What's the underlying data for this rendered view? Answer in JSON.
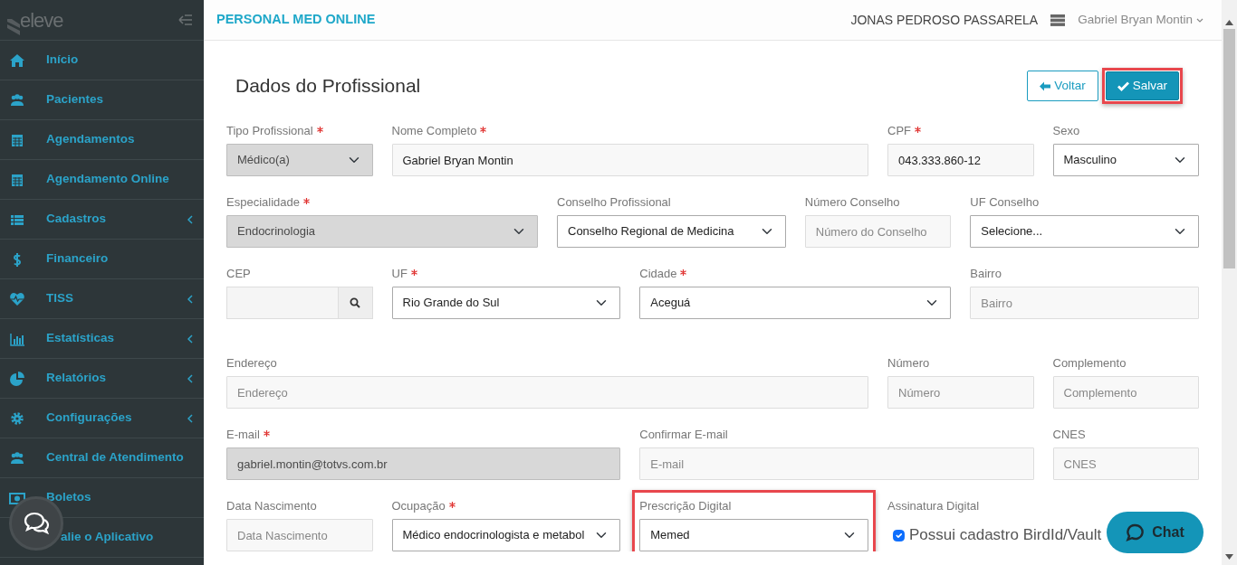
{
  "sidebar": {
    "logo": "eleve",
    "items": [
      {
        "label": "Início",
        "has_submenu": false
      },
      {
        "label": "Pacientes",
        "has_submenu": false
      },
      {
        "label": "Agendamentos",
        "has_submenu": false
      },
      {
        "label": "Agendamento Online",
        "has_submenu": false
      },
      {
        "label": "Cadastros",
        "has_submenu": true
      },
      {
        "label": "Financeiro",
        "has_submenu": false
      },
      {
        "label": "TISS",
        "has_submenu": true
      },
      {
        "label": "Estatísticas",
        "has_submenu": true
      },
      {
        "label": "Relatórios",
        "has_submenu": true
      },
      {
        "label": "Configurações",
        "has_submenu": true
      },
      {
        "label": "Central de Atendimento",
        "has_submenu": false
      },
      {
        "label": "Boletos",
        "has_submenu": false
      },
      {
        "label": "alie o Aplicativo",
        "has_submenu": false
      }
    ]
  },
  "header": {
    "app_title": "PERSONAL MED ONLINE",
    "clinic": "JONAS PEDROSO PASSARELA",
    "user": "Gabriel Bryan Montin"
  },
  "page": {
    "title": "Dados do Profissional",
    "buttons": [
      {
        "label": "Voltar",
        "kind": "back",
        "highlighted": false
      },
      {
        "label": "Salvar",
        "kind": "save",
        "highlighted": true
      }
    ]
  },
  "form": {
    "rows": [
      {
        "fields": [
          {
            "label": "Tipo Profissional",
            "required": true,
            "kind": "select",
            "value": "Médico(a)",
            "disabled": true,
            "highlighted": false
          },
          {
            "label": "Nome Completo",
            "required": true,
            "kind": "input",
            "value": "Gabriel Bryan Montin",
            "disabled": false,
            "highlighted": false
          },
          {
            "label": "CPF",
            "required": true,
            "kind": "input",
            "value": "043.333.860-12",
            "disabled": false,
            "highlighted": false
          },
          {
            "label": "Sexo",
            "required": false,
            "kind": "select",
            "value": "Masculino",
            "disabled": false,
            "highlighted": false
          }
        ]
      },
      {
        "fields": [
          {
            "label": "Especialidade",
            "required": true,
            "kind": "select",
            "value": "Endocrinologia",
            "disabled": true,
            "highlighted": false
          },
          {
            "label": "Conselho Profissional",
            "required": false,
            "kind": "select",
            "value": "Conselho Regional de Medicina",
            "disabled": false,
            "highlighted": false
          },
          {
            "label": "Número Conselho",
            "required": false,
            "kind": "input",
            "placeholder": "Número do Conselho",
            "disabled": false,
            "highlighted": false
          },
          {
            "label": "UF Conselho",
            "required": false,
            "kind": "select",
            "value": "Selecione...",
            "disabled": false,
            "highlighted": false
          }
        ]
      },
      {
        "fields": [
          {
            "label": "CEP",
            "required": false,
            "kind": "search",
            "disabled": false,
            "highlighted": false
          },
          {
            "label": "UF",
            "required": true,
            "kind": "select",
            "value": "Rio Grande do Sul",
            "disabled": false,
            "highlighted": false
          },
          {
            "label": "Cidade",
            "required": true,
            "kind": "select",
            "value": "Aceguá",
            "disabled": false,
            "highlighted": false
          },
          {
            "label": "Bairro",
            "required": false,
            "kind": "input",
            "placeholder": "Bairro",
            "disabled": false,
            "highlighted": false
          }
        ]
      },
      {
        "fields": [
          {
            "label": "Endereço",
            "required": false,
            "kind": "input",
            "placeholder": "Endereço",
            "disabled": false,
            "highlighted": false
          },
          {
            "label": "Número",
            "required": false,
            "kind": "input",
            "placeholder": "Número",
            "disabled": false,
            "highlighted": false
          },
          {
            "label": "Complemento",
            "required": false,
            "kind": "input",
            "placeholder": "Complemento",
            "disabled": false,
            "highlighted": false
          }
        ]
      },
      {
        "fields": [
          {
            "label": "E-mail",
            "required": true,
            "kind": "input",
            "value": "gabriel.montin@totvs.com.br",
            "disabled": true,
            "highlighted": false
          },
          {
            "label": "Confirmar E-mail",
            "required": false,
            "kind": "input",
            "placeholder": "E-mail",
            "disabled": false,
            "highlighted": false
          },
          {
            "label": "CNES",
            "required": false,
            "kind": "input",
            "placeholder": "CNES",
            "disabled": false,
            "highlighted": false
          }
        ]
      },
      {
        "fields": [
          {
            "label": "Data Nascimento",
            "required": false,
            "kind": "input",
            "placeholder": "Data Nascimento",
            "disabled": false,
            "highlighted": false
          },
          {
            "label": "Ocupação",
            "required": true,
            "kind": "select",
            "value": "Médico endocrinologista e metabol",
            "disabled": false,
            "highlighted": false
          },
          {
            "label": "Prescrição Digital",
            "required": false,
            "kind": "select",
            "value": "Memed",
            "disabled": false,
            "highlighted": true
          },
          {
            "label": "Assinatura Digital",
            "required": false,
            "kind": "checkbox",
            "text": "Possui cadastro BirdId/Vault",
            "checked": true,
            "disabled": false,
            "highlighted": false
          }
        ]
      }
    ]
  },
  "chat_button": {
    "label": "Chat"
  }
}
